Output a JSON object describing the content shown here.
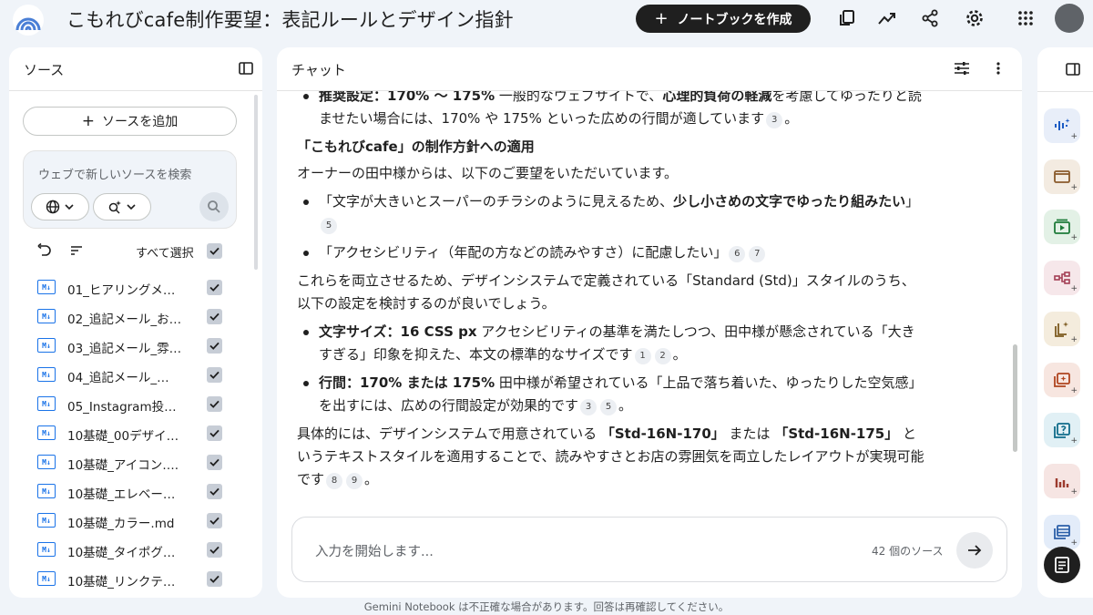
{
  "header": {
    "title": "こもれびcafe制作要望：表記ルールとデザイン指針",
    "create_button": "ノートブックを作成",
    "icons": [
      "analytics-icon",
      "share-icon",
      "settings-icon",
      "apps-icon"
    ]
  },
  "sources": {
    "title": "ソース",
    "add_button": "ソースを追加",
    "search_placeholder": "ウェブで新しいソースを検索",
    "select_all": "すべて選択",
    "items": [
      {
        "name": "01_ヒアリングメ…"
      },
      {
        "name": "02_追記メール_お…"
      },
      {
        "name": "03_追記メール_雰…"
      },
      {
        "name": "04_追記メール_…"
      },
      {
        "name": "05_Instagram投…"
      },
      {
        "name": "10基礎_00デザイ…"
      },
      {
        "name": "10基礎_アイコン…."
      },
      {
        "name": "10基礎_エレベー…"
      },
      {
        "name": "10基礎_カラー.md"
      },
      {
        "name": "10基礎_タイポグ…"
      },
      {
        "name": "10基礎_リンクテ…"
      }
    ]
  },
  "chat": {
    "title": "チャット",
    "b1_label": "推奨設定：170% 〜 175%",
    "b1_text_a": " 一般的なウェブサイトで、",
    "b1_bold": "心理的負荷の軽減",
    "b1_text_b": "を考慮してゆったりと読ませたい場合には、170% や 175% といった広めの行間が適しています",
    "b1_cite": "3",
    "b1_end": "。",
    "section_heading": "「こもれびcafe」の制作方針への適用",
    "intro": "オーナーの田中様からは、以下のご要望をいただいています。",
    "req1_a": "「文字が大きいとスーパーのチラシのように見えるため、",
    "req1_bold": "少し小さめの文字でゆったり組みたい",
    "req1_b": "」",
    "req1_cite": "5",
    "req2": "「アクセシビリティ（年配の方などの読みやすさ）に配慮したい」",
    "req2_cite1": "6",
    "req2_cite2": "7",
    "para2": "これらを両立させるため、デザインシステムで定義されている「Standard (Std)」スタイルのうち、以下の設定を検討するのが良いでしょう。",
    "s1_label": "文字サイズ：16 CSS px",
    "s1_text": " アクセシビリティの基準を満たしつつ、田中様が懸念されている「大きすぎる」印象を抑えた、本文の標準的なサイズです",
    "s1_cite1": "1",
    "s1_cite2": "2",
    "s1_end": "。",
    "s2_label": "行間：170% または 175%",
    "s2_text": " 田中様が希望されている「上品で落ち着いた、ゆったりした空気感」を出すには、広めの行間設定が効果的です",
    "s2_cite1": "3",
    "s2_cite2": "5",
    "s2_end": "。",
    "para3_a": "具体的には、デザインシステムで用意されている ",
    "para3_b1": "「Std-16N-170」",
    "para3_mid": " または ",
    "para3_b2": "「Std-16N-175」",
    "para3_c": " というテキストスタイルを適用することで、読みやすさとお店の雰囲気を両立したレイアウトが実現可能です",
    "para3_cite1": "8",
    "para3_cite2": "9",
    "para3_end": "。",
    "input_placeholder": "入力を開始します...",
    "source_count": "42 個のソース"
  },
  "footer": {
    "note": "Gemini Notebook は不正確な場合があります。回答は再確認してください。"
  },
  "colors": {
    "accent": "#1a73e8",
    "background": "#f0f4f9",
    "dark": "#1f1f1f"
  }
}
